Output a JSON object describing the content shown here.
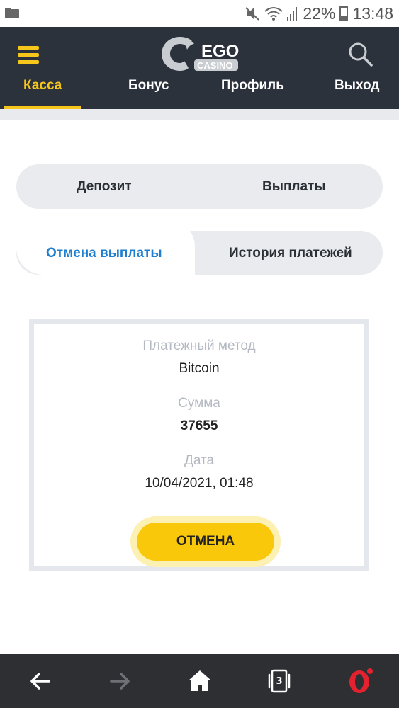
{
  "status_bar": {
    "battery_percent": "22%",
    "time": "13:48"
  },
  "header": {
    "logo_text_top": "EGO",
    "logo_text_bottom": "CASINO",
    "nav": [
      {
        "label": "Касса",
        "active": true
      },
      {
        "label": "Бонус",
        "active": false
      },
      {
        "label": "Профиль",
        "active": false
      },
      {
        "label": "Выход",
        "active": false
      }
    ]
  },
  "tabs_primary": [
    {
      "label": "Депозит"
    },
    {
      "label": "Выплаты"
    }
  ],
  "tabs_secondary": [
    {
      "label": "Отмена выплаты",
      "active": true
    },
    {
      "label": "История платежей",
      "active": false
    }
  ],
  "withdrawal": {
    "method_label": "Платежный метод",
    "method_value": "Bitcoin",
    "amount_label": "Сумма",
    "amount_value": "37655",
    "date_label": "Дата",
    "date_value": "10/04/2021, 01:48",
    "cancel_label": "ОТМЕНА"
  },
  "browser_bar": {
    "tabs_count": "3"
  },
  "colors": {
    "header_bg": "#2b323b",
    "accent_yellow": "#f6c61a",
    "active_tab_text": "#1e7fd0",
    "button_yellow": "#f9c80a"
  }
}
